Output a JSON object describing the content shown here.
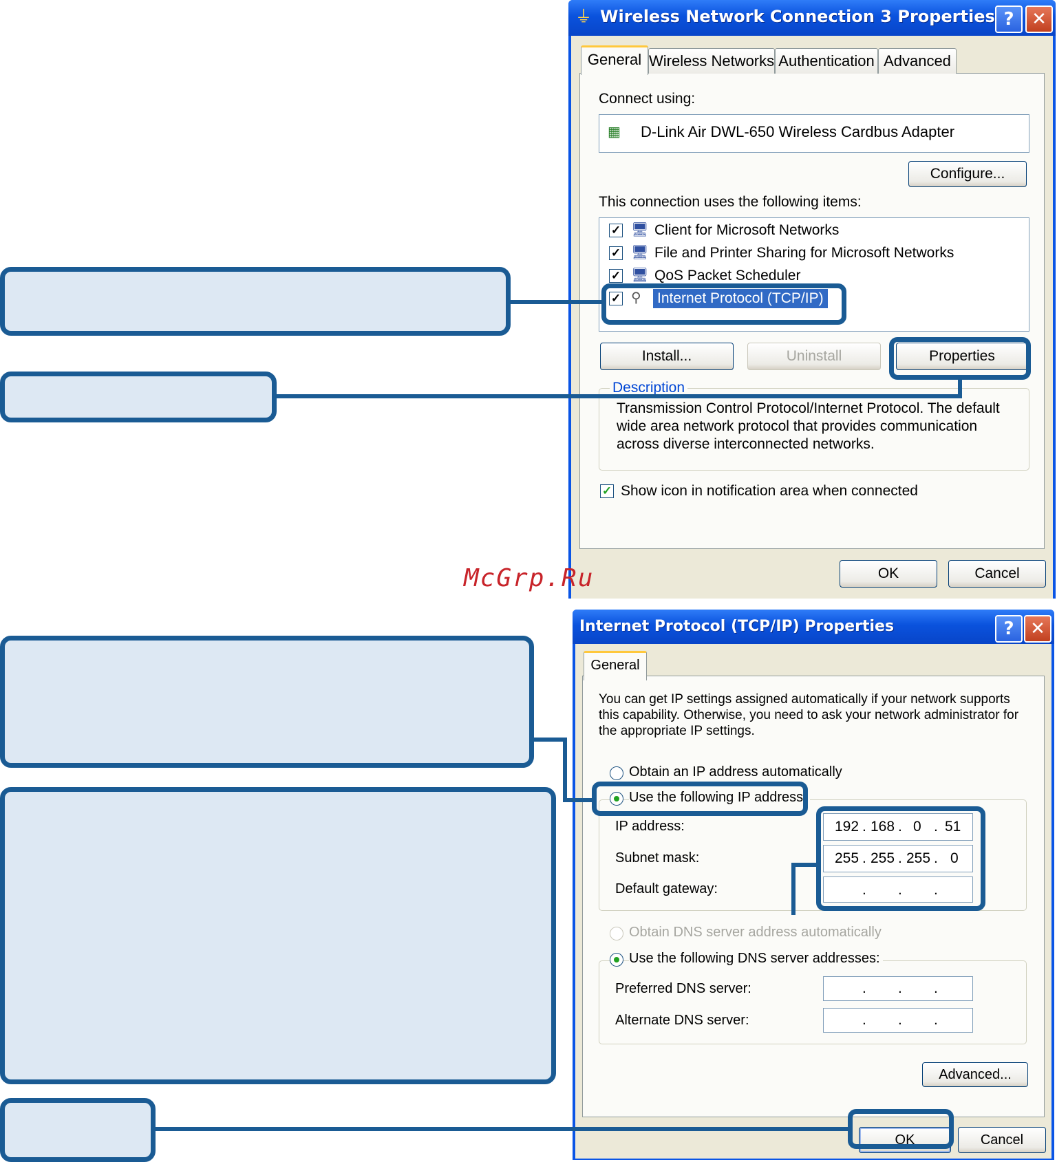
{
  "dialog1": {
    "title": "Wireless Network Connection 3 Properties",
    "tabs": [
      "General",
      "Wireless Networks",
      "Authentication",
      "Advanced"
    ],
    "connect_using_label": "Connect using:",
    "adapter_name": "D-Link Air DWL-650 Wireless Cardbus Adapter",
    "configure_label": "Configure...",
    "items_label": "This connection uses the following items:",
    "items": [
      {
        "label": "Client for Microsoft Networks",
        "checked": true
      },
      {
        "label": "File and Printer Sharing for Microsoft Networks",
        "checked": true
      },
      {
        "label": "QoS Packet Scheduler",
        "checked": true
      },
      {
        "label": "Internet Protocol (TCP/IP)",
        "checked": true
      }
    ],
    "install_label": "Install...",
    "uninstall_label": "Uninstall",
    "properties_label": "Properties",
    "description_label": "Description",
    "description_line1": "Transmission Control Protocol/Internet Protocol. The default",
    "description_line2": "wide area network protocol that provides communication",
    "description_line3": "across diverse interconnected networks.",
    "show_icon_label": "Show icon in notification area when connected",
    "ok_label": "OK",
    "cancel_label": "Cancel"
  },
  "dialog2": {
    "title": "Internet Protocol (TCP/IP) Properties",
    "tab": "General",
    "intro_line1": "You can get IP settings assigned automatically if your network supports",
    "intro_line2": "this capability. Otherwise, you need to ask your network administrator for",
    "intro_line3": "the appropriate IP settings.",
    "obtain_ip_auto": "Obtain an IP address automatically",
    "use_following_ip": "Use the following IP address:",
    "ip_address_label": "IP address:",
    "ip_address": [
      "192",
      "168",
      "0",
      "51"
    ],
    "subnet_mask_label": "Subnet mask:",
    "subnet_mask": [
      "255",
      "255",
      "255",
      "0"
    ],
    "default_gateway_label": "Default gateway:",
    "obtain_dns_auto": "Obtain DNS server address automatically",
    "use_following_dns": "Use the following DNS server addresses:",
    "preferred_dns_label": "Preferred DNS server:",
    "alternate_dns_label": "Alternate DNS server:",
    "advanced_label": "Advanced...",
    "ok_label": "OK",
    "cancel_label": "Cancel"
  },
  "watermark": "McGrp.Ru",
  "colors": {
    "callout_border": "#1a5b94",
    "callout_fill": "#dde8f3",
    "xp_title_blue": "#0a52dd",
    "watermark_red": "#c8242a"
  }
}
